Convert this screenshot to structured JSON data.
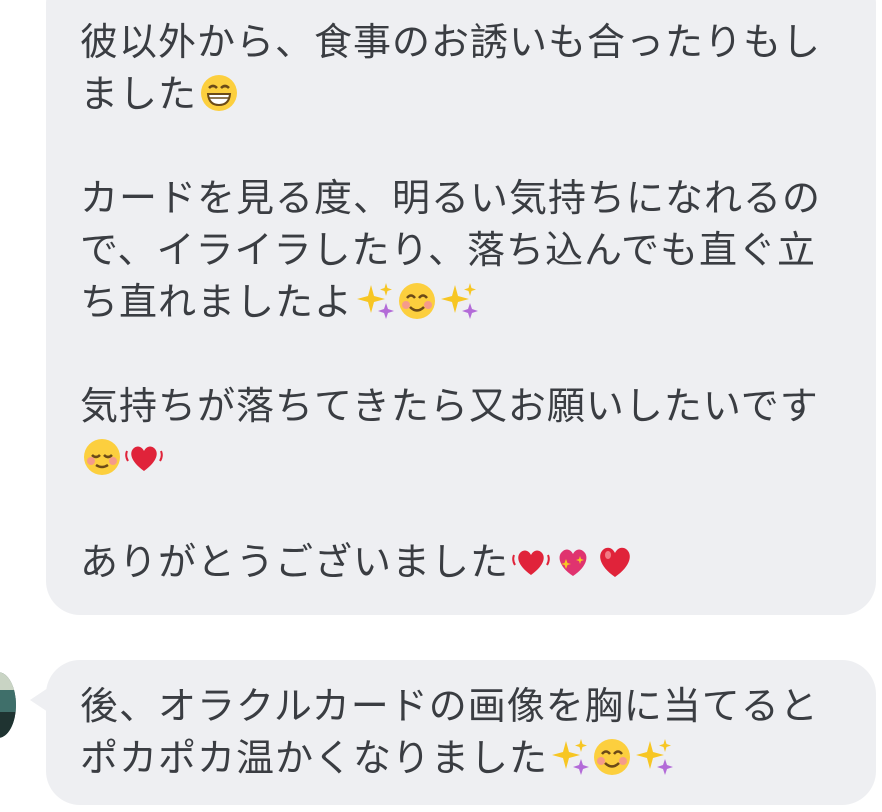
{
  "conversation": {
    "message_1": {
      "lines": [
        "彼以外から、食事のお誘いも合ったりもし",
        "ました",
        "",
        "カードを見る度、明るい気持ちになれるの",
        "で、イライラしたり、落ち込んでも直ぐ立",
        "ち直れましたよ",
        "",
        "気持ちが落ちてきたら又お願いしたいです",
        "",
        "",
        "ありがとうございました"
      ],
      "emojis": {
        "line2": [
          "grinning-face-icon"
        ],
        "line6": [
          "sparkles-icon",
          "smiling-face-icon",
          "sparkles-icon"
        ],
        "line9": [
          "relieved-face-icon",
          "beating-heart-icon"
        ],
        "line11": [
          "beating-heart-icon",
          "sparkling-heart-icon",
          "red-heart-icon"
        ]
      }
    },
    "message_2": {
      "lines": [
        "後、オラクルカードの画像を胸に当てると",
        "ポカポカ温かくなりました"
      ],
      "emojis": {
        "line2": [
          "sparkles-icon",
          "smiling-face-icon",
          "sparkles-icon"
        ]
      }
    }
  },
  "colors": {
    "bubble_bg": "#eeeff2",
    "text": "#3a3d42",
    "heart_red": "#e0233a",
    "sparkle_yellow": "#f7c623",
    "face_yellow": "#fccf3e"
  }
}
